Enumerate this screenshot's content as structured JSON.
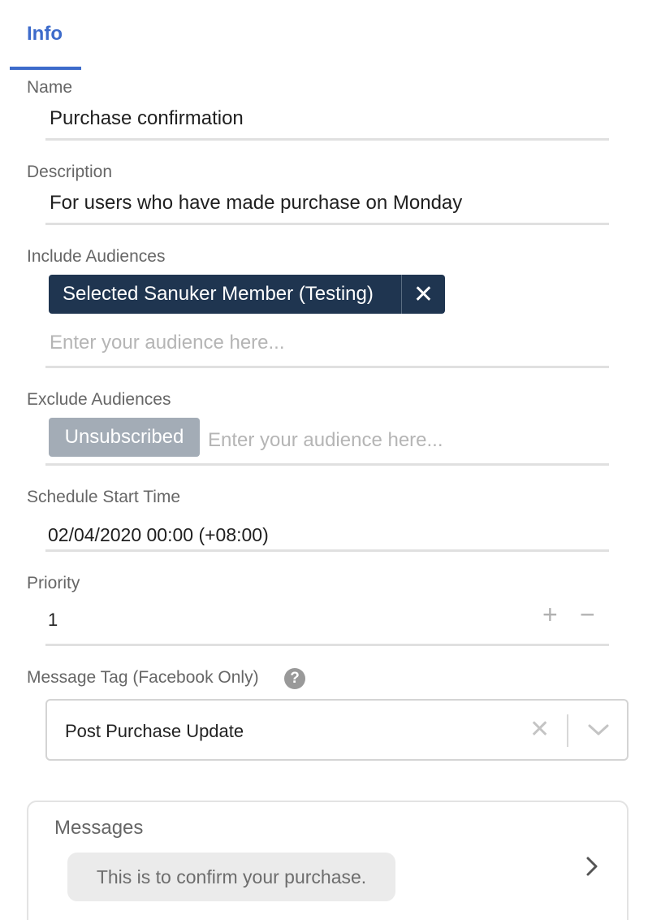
{
  "tabs": {
    "info_label": "Info"
  },
  "name": {
    "label": "Name",
    "value": "Purchase confirmation"
  },
  "description": {
    "label": "Description",
    "value": "For users who have made purchase on Monday"
  },
  "include_audiences": {
    "label": "Include Audiences",
    "chips": [
      {
        "label": "Selected Sanuker Member (Testing)",
        "remove_icon": "close-icon"
      }
    ],
    "placeholder": "Enter your audience here..."
  },
  "exclude_audiences": {
    "label": "Exclude Audiences",
    "chips": [
      {
        "label": "Unsubscribed"
      }
    ],
    "placeholder": "Enter your audience here..."
  },
  "schedule": {
    "label": "Schedule Start Time",
    "value": "02/04/2020 00:00 (+08:00)"
  },
  "priority": {
    "label": "Priority",
    "value": "1",
    "increment_glyph": "+",
    "decrement_glyph": "−"
  },
  "message_tag": {
    "label": "Message Tag (Facebook Only)",
    "help_glyph": "?",
    "selected": "Post Purchase Update",
    "clear_glyph": "✕"
  },
  "messages": {
    "title": "Messages",
    "items": [
      {
        "text": "This is to confirm your purchase."
      }
    ]
  },
  "colors": {
    "accent": "#3d6bcb",
    "chip_dark": "#1f3550",
    "chip_gray": "#a3acb6"
  }
}
